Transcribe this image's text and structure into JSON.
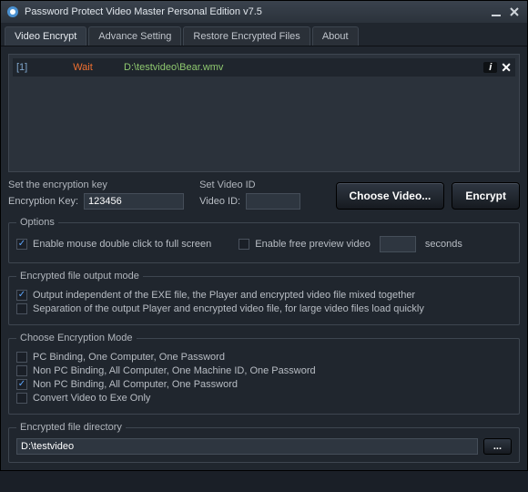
{
  "title": "Password Protect Video Master Personal Edition v7.5",
  "tabs": [
    "Video Encrypt",
    "Advance Setting",
    "Restore Encrypted Files",
    "About"
  ],
  "file": {
    "idx": "[1]",
    "status": "Wait",
    "path": "D:\\testvideo\\Bear.wmv"
  },
  "key_section": {
    "title": "Set the encryption key",
    "label": "Encryption Key:",
    "value": "123456"
  },
  "id_section": {
    "title": "Set Video ID",
    "label": "Video ID:",
    "value": ""
  },
  "buttons": {
    "choose": "Choose Video...",
    "encrypt": "Encrypt",
    "browse": "..."
  },
  "options": {
    "legend": "Options",
    "fullscreen": "Enable mouse double click to full screen",
    "preview": "Enable free preview video",
    "seconds": "seconds"
  },
  "output_mode": {
    "legend": "Encrypted file output mode",
    "opt1": "Output independent of the EXE file, the Player and encrypted video file mixed together",
    "opt2": "Separation of the output Player and encrypted video file, for large video files load quickly"
  },
  "enc_mode": {
    "legend": "Choose Encryption Mode",
    "opt1": "PC Binding, One Computer, One Password",
    "opt2": "Non PC Binding, All Computer, One Machine ID, One Password",
    "opt3": "Non PC Binding, All Computer, One Password",
    "opt4": "Convert Video to Exe Only"
  },
  "dir": {
    "legend": "Encrypted file directory",
    "value": "D:\\testvideo"
  }
}
